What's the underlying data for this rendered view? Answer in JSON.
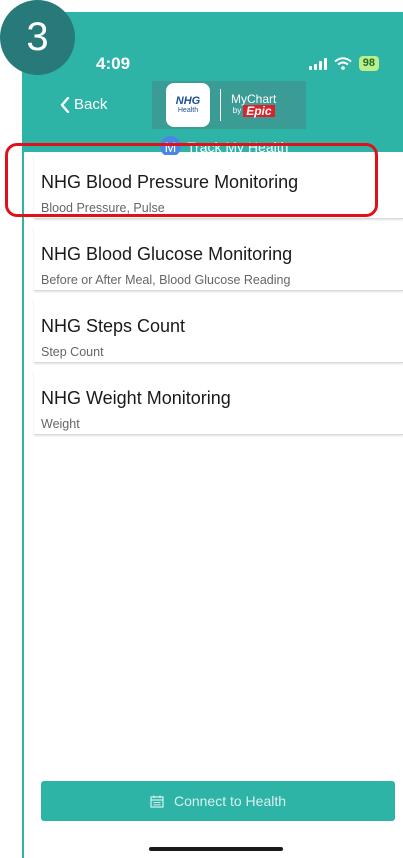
{
  "step_number": "3",
  "status_bar": {
    "time": "4:09",
    "battery": "98"
  },
  "nav": {
    "back_label": "Back"
  },
  "logo": {
    "nhg_text": "NHG",
    "nhg_sub": "Health",
    "mychart_text": "MyChart",
    "by_text": "by",
    "epic_text": "Epic"
  },
  "header": {
    "avatar_letter": "M",
    "title": "Track My Health"
  },
  "items": [
    {
      "title": "NHG Blood Pressure Monitoring",
      "subtitle": "Blood Pressure, Pulse"
    },
    {
      "title": "NHG Blood Glucose Monitoring",
      "subtitle": "Before or After Meal, Blood Glucose Reading"
    },
    {
      "title": "NHG Steps Count",
      "subtitle": "Step Count"
    },
    {
      "title": "NHG Weight Monitoring",
      "subtitle": "Weight"
    }
  ],
  "connect_button": {
    "label": "Connect to Health",
    "icon": "calendar-icon"
  },
  "colors": {
    "header": "#2eb3a7",
    "badge": "#27797a",
    "highlight": "#e0111a"
  }
}
